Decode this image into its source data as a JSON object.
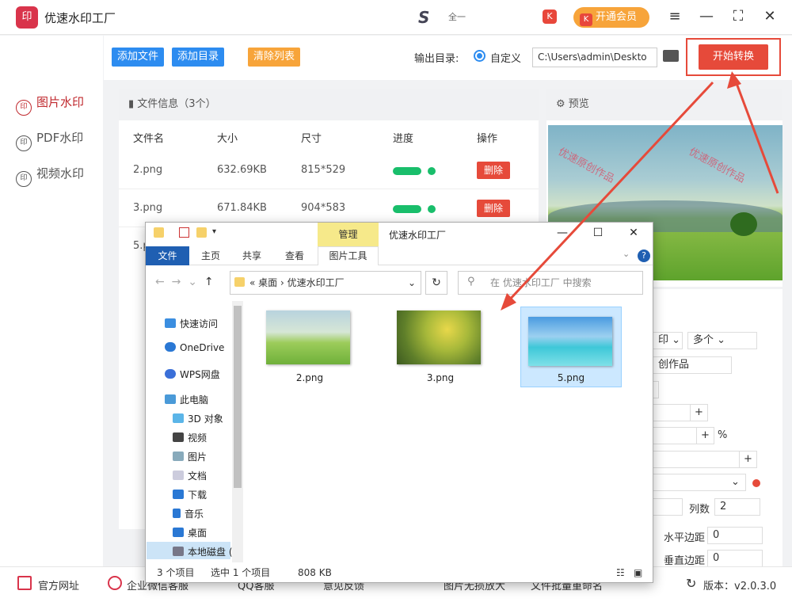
{
  "app": {
    "title": "优速水印工厂",
    "logo_text": "印",
    "brand_mark": "S",
    "brand_text": "全一",
    "vip_label": "开通会员"
  },
  "nav": [
    {
      "label": "图片水印",
      "active": true
    },
    {
      "label": "PDF水印",
      "active": false
    },
    {
      "label": "视频水印",
      "active": false
    }
  ],
  "toolbar": {
    "add_file": "添加文件",
    "add_dir": "添加目录",
    "clear_list": "清除列表",
    "output_label": "输出目录:",
    "custom_label": "自定义",
    "output_path": "C:\\Users\\admin\\Deskto",
    "start": "开始转换"
  },
  "files": {
    "header": "文件信息（3个）",
    "columns": [
      "文件名",
      "大小",
      "尺寸",
      "进度",
      "操作"
    ],
    "rows": [
      {
        "name": "2.png",
        "size": "632.69KB",
        "dims": "815*529",
        "delete": "删除"
      },
      {
        "name": "3.png",
        "size": "671.84KB",
        "dims": "904*583",
        "delete": "删除"
      },
      {
        "name": "5.p",
        "size": "",
        "dims": "",
        "delete": ""
      }
    ]
  },
  "preview": {
    "header": "预览",
    "watermark": "优速原创作品"
  },
  "settings": {
    "dropdown1": "印",
    "dropdown2": "多个",
    "text_value": "创作品",
    "percent": "%",
    "cols_label": "列数",
    "cols_value": "2",
    "hmargin_label": "水平边距",
    "hmargin_value": "0",
    "vmargin_label": "垂直边距",
    "vmargin_value": "0"
  },
  "footer": {
    "links": [
      "官方网址",
      "企业微信客服",
      "QQ客服",
      "意见反馈",
      "图片无损放大",
      "文件批量重命名"
    ],
    "version": "版本：v2.0.3.0"
  },
  "explorer": {
    "title": "优速水印工厂",
    "manage_tab": "管理",
    "ribbon_tabs": [
      "文件",
      "主页",
      "共享",
      "查看"
    ],
    "picture_tools": "图片工具",
    "address": [
      "«",
      "桌面",
      "›",
      "优速水印工厂"
    ],
    "search_placeholder": "在 优速水印工厂 中搜索",
    "tree": [
      "快速访问",
      "OneDrive",
      "WPS网盘",
      "此电脑",
      "3D 对象",
      "视频",
      "图片",
      "文档",
      "下载",
      "音乐",
      "桌面",
      "本地磁盘 ("
    ],
    "files": [
      "2.png",
      "3.png",
      "5.png"
    ],
    "status": {
      "count": "3 个项目",
      "selected": "选中 1 个项目",
      "size": "808 KB"
    }
  },
  "colors": {
    "accent_red": "#e64a3a",
    "blue_btn": "#2d8cf0",
    "orange_btn": "#f7a43a",
    "green": "#19be6b"
  }
}
